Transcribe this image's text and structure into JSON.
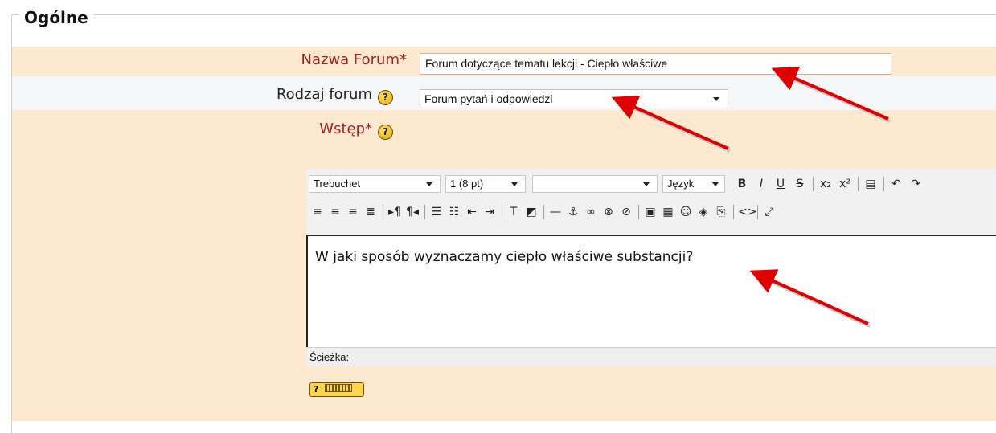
{
  "section": {
    "legend": "Ogólne"
  },
  "fields": {
    "name": {
      "label": "Nazwa Forum*",
      "value": "Forum dotyczące tematu lekcji - Ciepło właściwe"
    },
    "type": {
      "label": "Rodzaj forum",
      "value": "Forum pytań i odpowiedzi"
    },
    "intro": {
      "label": "Wstęp*"
    }
  },
  "help_icon": "question-mark-icon",
  "editor": {
    "font_family": "Trebuchet",
    "font_size": "1 (8 pt)",
    "format": "",
    "language": "Język",
    "content": "W jaki sposób wyznaczamy ciepło właściwe substancji?",
    "path_label": "Ścieżka:",
    "toolbar_row1": [
      {
        "name": "bold-button",
        "glyph": "B"
      },
      {
        "name": "italic-button",
        "glyph": "I"
      },
      {
        "name": "underline-button",
        "glyph": "U"
      },
      {
        "name": "strikethrough-button",
        "glyph": "S"
      },
      {
        "name": "subscript-button",
        "glyph": "x₂"
      },
      {
        "name": "superscript-button",
        "glyph": "x²"
      },
      {
        "name": "paste-word-button",
        "glyph": "▤"
      },
      {
        "name": "undo-button",
        "glyph": "↶"
      },
      {
        "name": "redo-button",
        "glyph": "↷"
      }
    ],
    "toolbar_row2": [
      {
        "name": "align-left-button",
        "glyph": "≡"
      },
      {
        "name": "align-center-button",
        "glyph": "≡"
      },
      {
        "name": "align-right-button",
        "glyph": "≡"
      },
      {
        "name": "justify-button",
        "glyph": "≣"
      },
      {
        "name": "ltr-button",
        "glyph": "▸¶"
      },
      {
        "name": "rtl-button",
        "glyph": "¶◂"
      },
      {
        "name": "ordered-list-button",
        "glyph": "☰"
      },
      {
        "name": "unordered-list-button",
        "glyph": "☷"
      },
      {
        "name": "outdent-button",
        "glyph": "⇤"
      },
      {
        "name": "indent-button",
        "glyph": "⇥"
      },
      {
        "name": "text-color-button",
        "glyph": "T"
      },
      {
        "name": "background-color-button",
        "glyph": "◩"
      },
      {
        "name": "horizontal-rule-button",
        "glyph": "—"
      },
      {
        "name": "anchor-button",
        "glyph": "⚓"
      },
      {
        "name": "link-button",
        "glyph": "∞"
      },
      {
        "name": "unlink-button",
        "glyph": "⊗"
      },
      {
        "name": "nolink-button",
        "glyph": "⊘"
      },
      {
        "name": "image-button",
        "glyph": "▣"
      },
      {
        "name": "table-button",
        "glyph": "▦"
      },
      {
        "name": "smiley-button",
        "glyph": "☺"
      },
      {
        "name": "spellcheck-button",
        "glyph": "◈"
      },
      {
        "name": "search-replace-button",
        "glyph": "⎘"
      },
      {
        "name": "html-source-button",
        "glyph": "<>"
      },
      {
        "name": "fullscreen-button",
        "glyph": "⤢"
      }
    ]
  },
  "keyboard_help": "?",
  "colors": {
    "required_label": "#a32222",
    "band": "#fde9cf",
    "arrow": "#e00000"
  }
}
